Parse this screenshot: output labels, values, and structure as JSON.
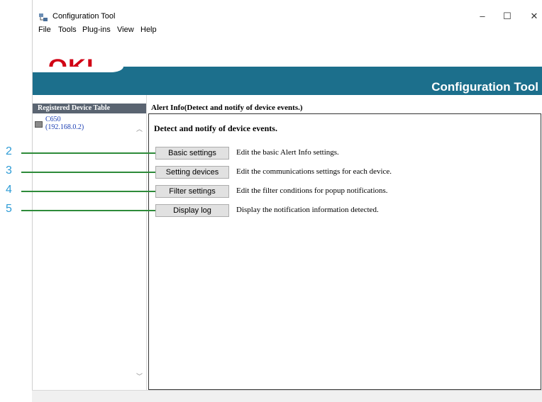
{
  "window": {
    "title": "Configuration Tool"
  },
  "window_controls": {
    "minimize": "–",
    "maximize": "☐",
    "close": "✕"
  },
  "menu": [
    "File",
    "Tools",
    "Plug-ins",
    "View",
    "Help"
  ],
  "logo": {
    "text": "OKI"
  },
  "banner": {
    "title": "Configuration Tool"
  },
  "left_panel": {
    "header": "Registered Device Table",
    "device": {
      "name": "C650",
      "ip": "(192.168.0.2)"
    }
  },
  "content": {
    "header": "Alert Info(Detect and notify of device events.)",
    "subtitle": "Detect and notify of device events.",
    "actions": [
      {
        "button": "Basic settings",
        "description": "Edit the basic Alert Info settings."
      },
      {
        "button": "Setting devices",
        "description": "Edit the communications settings for each device."
      },
      {
        "button": "Filter settings",
        "description": "Edit the filter conditions for popup notifications."
      },
      {
        "button": "Display log",
        "description": "Display the notification information detected."
      }
    ]
  },
  "callouts": [
    "2",
    "3",
    "4",
    "5"
  ],
  "colors": {
    "banner": "#1c6f8c",
    "logo": "#d10014",
    "callout_line": "#2e8b3a",
    "callout_number": "#2e9cd6"
  },
  "icons": {
    "app": "configuration-tool-icon",
    "device": "printer-icon",
    "scroll_up": "chevron-up-icon",
    "scroll_down": "chevron-down-icon"
  }
}
